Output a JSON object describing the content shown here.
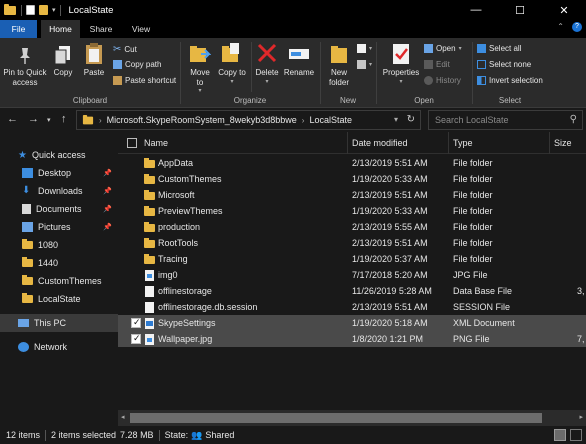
{
  "window": {
    "title": "LocalState",
    "minimize": "—",
    "maximize": "☐",
    "close": "✕"
  },
  "tabs": {
    "file": "File",
    "home": "Home",
    "share": "Share",
    "view": "View",
    "help": "?"
  },
  "ribbon": {
    "clipboard": {
      "group_label": "Clipboard",
      "pin": "Pin to Quick access",
      "copy": "Copy",
      "paste": "Paste",
      "cut": "Cut",
      "copy_path": "Copy path",
      "paste_shortcut": "Paste shortcut"
    },
    "organize": {
      "group_label": "Organize",
      "move_to": "Move to",
      "copy_to": "Copy to",
      "delete": "Delete",
      "rename": "Rename"
    },
    "new": {
      "group_label": "New",
      "new_folder": "New folder"
    },
    "open": {
      "group_label": "Open",
      "properties": "Properties",
      "open": "Open",
      "edit": "Edit",
      "history": "History"
    },
    "select": {
      "group_label": "Select",
      "select_all": "Select all",
      "select_none": "Select none",
      "invert_selection": "Invert selection"
    }
  },
  "address": {
    "crumbs": [
      "Microsoft.SkypeRoomSystem_8wekyb3d8bbwe",
      "LocalState"
    ],
    "search_placeholder": "Search LocalState"
  },
  "nav_pane": {
    "quick_access": "Quick access",
    "items": [
      {
        "label": "Desktop",
        "icon": "desktop-icon",
        "pinned": true
      },
      {
        "label": "Downloads",
        "icon": "download-icon",
        "pinned": true
      },
      {
        "label": "Documents",
        "icon": "documents-icon",
        "pinned": true
      },
      {
        "label": "Pictures",
        "icon": "pictures-icon",
        "pinned": true
      },
      {
        "label": "1080",
        "icon": "folder-icon",
        "pinned": false
      },
      {
        "label": "1440",
        "icon": "folder-icon",
        "pinned": false
      },
      {
        "label": "CustomThemes",
        "icon": "folder-icon",
        "pinned": false
      },
      {
        "label": "LocalState",
        "icon": "folder-icon",
        "pinned": false
      }
    ],
    "this_pc": "This PC",
    "network": "Network"
  },
  "columns": {
    "name": "Name",
    "date": "Date modified",
    "type": "Type",
    "size": "Size"
  },
  "files": [
    {
      "name": "AppData",
      "date": "2/13/2019 5:51 AM",
      "type": "File folder",
      "size": "",
      "kind": "folder",
      "selected": false
    },
    {
      "name": "CustomThemes",
      "date": "1/19/2020 5:33 AM",
      "type": "File folder",
      "size": "",
      "kind": "folder",
      "selected": false
    },
    {
      "name": "Microsoft",
      "date": "2/13/2019 5:51 AM",
      "type": "File folder",
      "size": "",
      "kind": "folder",
      "selected": false
    },
    {
      "name": "PreviewThemes",
      "date": "1/19/2020 5:33 AM",
      "type": "File folder",
      "size": "",
      "kind": "folder",
      "selected": false
    },
    {
      "name": "production",
      "date": "2/13/2019 5:55 AM",
      "type": "File folder",
      "size": "",
      "kind": "folder",
      "selected": false
    },
    {
      "name": "RootTools",
      "date": "2/13/2019 5:51 AM",
      "type": "File folder",
      "size": "",
      "kind": "folder",
      "selected": false
    },
    {
      "name": "Tracing",
      "date": "1/19/2020 5:37 AM",
      "type": "File folder",
      "size": "",
      "kind": "folder",
      "selected": false
    },
    {
      "name": "img0",
      "date": "7/17/2018 5:20 AM",
      "type": "JPG File",
      "size": "",
      "kind": "image",
      "selected": false
    },
    {
      "name": "offlinestorage",
      "date": "11/26/2019 5:28 AM",
      "type": "Data Base File",
      "size": "3,",
      "kind": "doc",
      "selected": false
    },
    {
      "name": "offlinestorage.db.session",
      "date": "2/13/2019 5:51 AM",
      "type": "SESSION File",
      "size": "",
      "kind": "doc",
      "selected": false
    },
    {
      "name": "SkypeSettings",
      "date": "1/19/2020 5:18 AM",
      "type": "XML Document",
      "size": "",
      "kind": "xml",
      "selected": true
    },
    {
      "name": "Wallpaper.jpg",
      "date": "1/8/2020 1:21 PM",
      "type": "PNG File",
      "size": "7,",
      "kind": "image",
      "selected": true
    }
  ],
  "status": {
    "count": "12 items",
    "selected": "2 items selected",
    "size": "7.28 MB",
    "state_label": "State:",
    "state_value": "Shared"
  },
  "colors": {
    "accent": "#1a5fb4",
    "folder": "#e7b743",
    "selection": "#4a4a4a",
    "background": "#191919"
  }
}
